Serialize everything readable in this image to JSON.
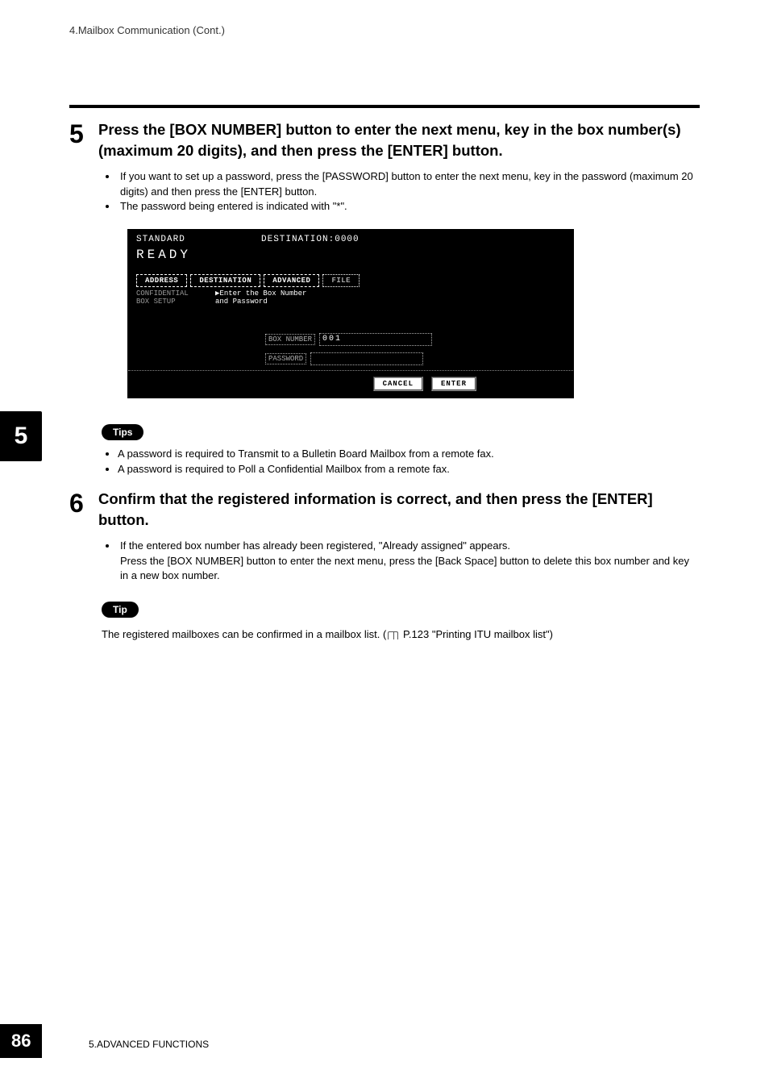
{
  "breadcrumb": "4.Mailbox Communication (Cont.)",
  "step5": {
    "number": "5",
    "title": "Press the [BOX NUMBER] button to enter the next menu, key in the box number(s) (maximum 20 digits), and then press the [ENTER] button.",
    "bullets": [
      "If you want to set up a password, press the [PASSWORD] button to enter the next menu, key in the password (maximum 20 digits) and then press the [ENTER] button.",
      "The password being entered is indicated with \"*\"."
    ]
  },
  "screenshot": {
    "standard": "STANDARD",
    "destination": "DESTINATION:0000",
    "ready": "READY",
    "tabs": {
      "address": "ADDRESS",
      "destination": "DESTINATION",
      "advanced": "ADVANCED",
      "file": "FILE"
    },
    "conf_line1": "CONFIDENTIAL",
    "conf_line2": "BOX SETUP",
    "enter_line1": "▶Enter the Box Number",
    "enter_line2": "  and Password",
    "box_number_label": "BOX NUMBER",
    "box_number_value": "001",
    "password_label": "PASSWORD",
    "password_value": "",
    "cancel": "CANCEL",
    "enter": "ENTER"
  },
  "tips_pill": "Tips",
  "tips_bullets": [
    "A password is required to Transmit to a Bulletin Board Mailbox from a remote fax.",
    "A password is required to Poll a Confidential Mailbox from a remote fax."
  ],
  "step6": {
    "number": "6",
    "title": "Confirm that the registered information is correct, and then press the [ENTER] button.",
    "bullets": [
      "If the entered box number has already been registered, \"Already assigned\" appears.\nPress the [BOX NUMBER] button to enter the next menu, press the [Back Space] button to delete this box number and key in a new box number."
    ]
  },
  "tip_pill": "Tip",
  "tip_text_pre": "The registered mailboxes can be confirmed in a mailbox list. (",
  "tip_text_post": " P.123 \"Printing ITU mailbox list\")",
  "side_tab": "5",
  "page_number": "86",
  "footer_text": "5.ADVANCED FUNCTIONS"
}
